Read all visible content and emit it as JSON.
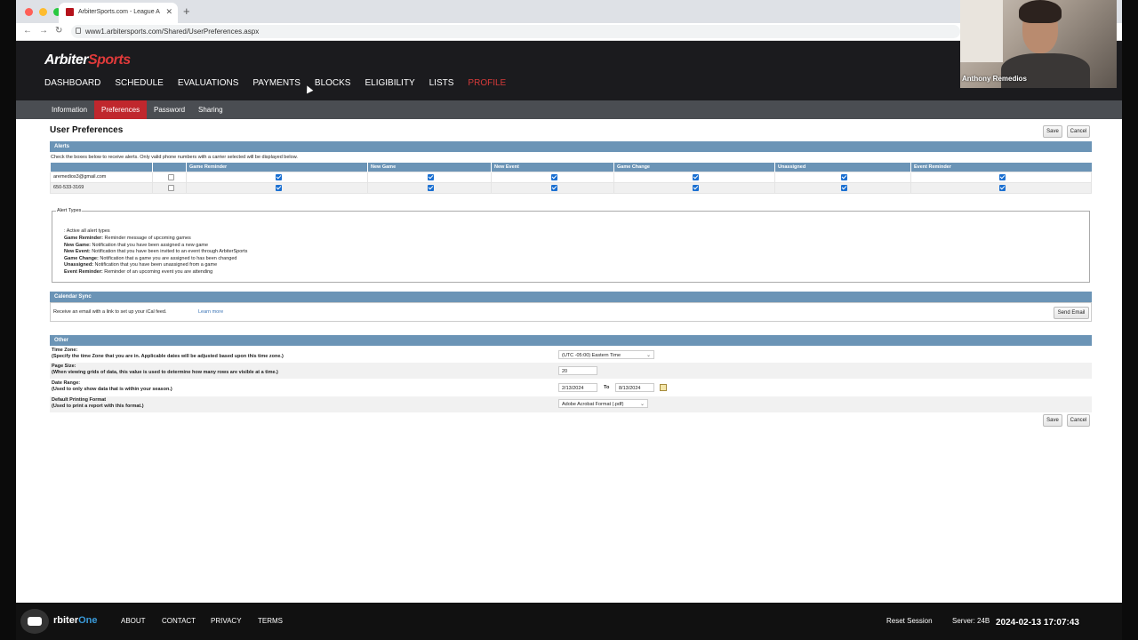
{
  "browser": {
    "tab_title": "ArbiterSports.com - League A",
    "url": "www1.arbitersports.com/Shared/UserPreferences.aspx",
    "traffic_colors": [
      "#ff5f57",
      "#febc2e",
      "#28c840"
    ]
  },
  "site": {
    "logo_part1": "Arbiter",
    "logo_part2": "Sports",
    "nav": [
      "DASHBOARD",
      "SCHEDULE",
      "EVALUATIONS",
      "PAYMENTS",
      "BLOCKS",
      "ELIGIBILITY",
      "LISTS",
      "PROFILE"
    ],
    "active_nav": "PROFILE",
    "subnav": [
      "Information",
      "Preferences",
      "Password",
      "Sharing"
    ],
    "active_subnav": "Preferences"
  },
  "page": {
    "title": "User Preferences",
    "save_label": "Save",
    "cancel_label": "Cancel"
  },
  "alerts": {
    "header": "Alerts",
    "instructions": "Check the boxes below to receive alerts. Only valid phone numbers with a carrier selected will be displayed below.",
    "columns": [
      "Game Reminder",
      "New Game",
      "New Event",
      "Game Change",
      "Unassigned",
      "Event Reminder"
    ],
    "rows": [
      {
        "contact": "aremedios3@gmail.com",
        "all": false,
        "checks": [
          true,
          true,
          true,
          true,
          true,
          true
        ]
      },
      {
        "contact": "650-533-3169",
        "all": false,
        "checks": [
          true,
          true,
          true,
          true,
          true,
          true
        ]
      }
    ]
  },
  "alert_types": {
    "legend": "Alert Types",
    "intro": ": Active all alert types",
    "items": [
      {
        "name": "Game Reminder:",
        "desc": "Reminder message of upcoming games"
      },
      {
        "name": "New Game:",
        "desc": "Notification that you have been assigned a new game"
      },
      {
        "name": "New Event:",
        "desc": "Notification that you have been invited to an event through ArbiterSports"
      },
      {
        "name": "Game Change:",
        "desc": "Notification that a game you are assigned to has been changed"
      },
      {
        "name": "Unassigned:",
        "desc": "Notification that you have been unassigned from a game"
      },
      {
        "name": "Event Reminder:",
        "desc": "Reminder of an upcoming event you are attending"
      }
    ]
  },
  "calendar_sync": {
    "header": "Calendar Sync",
    "text": "Receive an email with a link to set up your iCal feed.",
    "link": "Learn more",
    "button": "Send Email"
  },
  "other": {
    "header": "Other",
    "time_zone_label": "Time Zone:",
    "time_zone_help": "(Specify the time Zone that you are in. Applicable dates will be adjusted based upon this time zone.)",
    "time_zone_value": "(UTC -05:00) Eastern Time",
    "page_size_label": "Page Size:",
    "page_size_help": "(When viewing grids of data, this value is used to determine how many rows are visible at a time.)",
    "page_size_value": "20",
    "date_range_label": "Date Range:",
    "date_range_help": "(Used to only show data that is within your season.)",
    "date_from": "2/13/2024",
    "date_to_label": "To",
    "date_to": "8/13/2024",
    "print_label": "Default Printing Format",
    "print_help": "(Used to print a report with this format.)",
    "print_value": "Adobe Acrobat Format (.pdf)"
  },
  "footer": {
    "logo_part1": "rbiter",
    "logo_part2": "One",
    "links": [
      "ABOUT",
      "CONTACT",
      "PRIVACY",
      "TERMS"
    ],
    "reset_session": "Reset Session",
    "server": "Server: 24B",
    "timestamp": "2024-02-13 17:07:43"
  },
  "webcam": {
    "name": "Anthony Remedios"
  }
}
